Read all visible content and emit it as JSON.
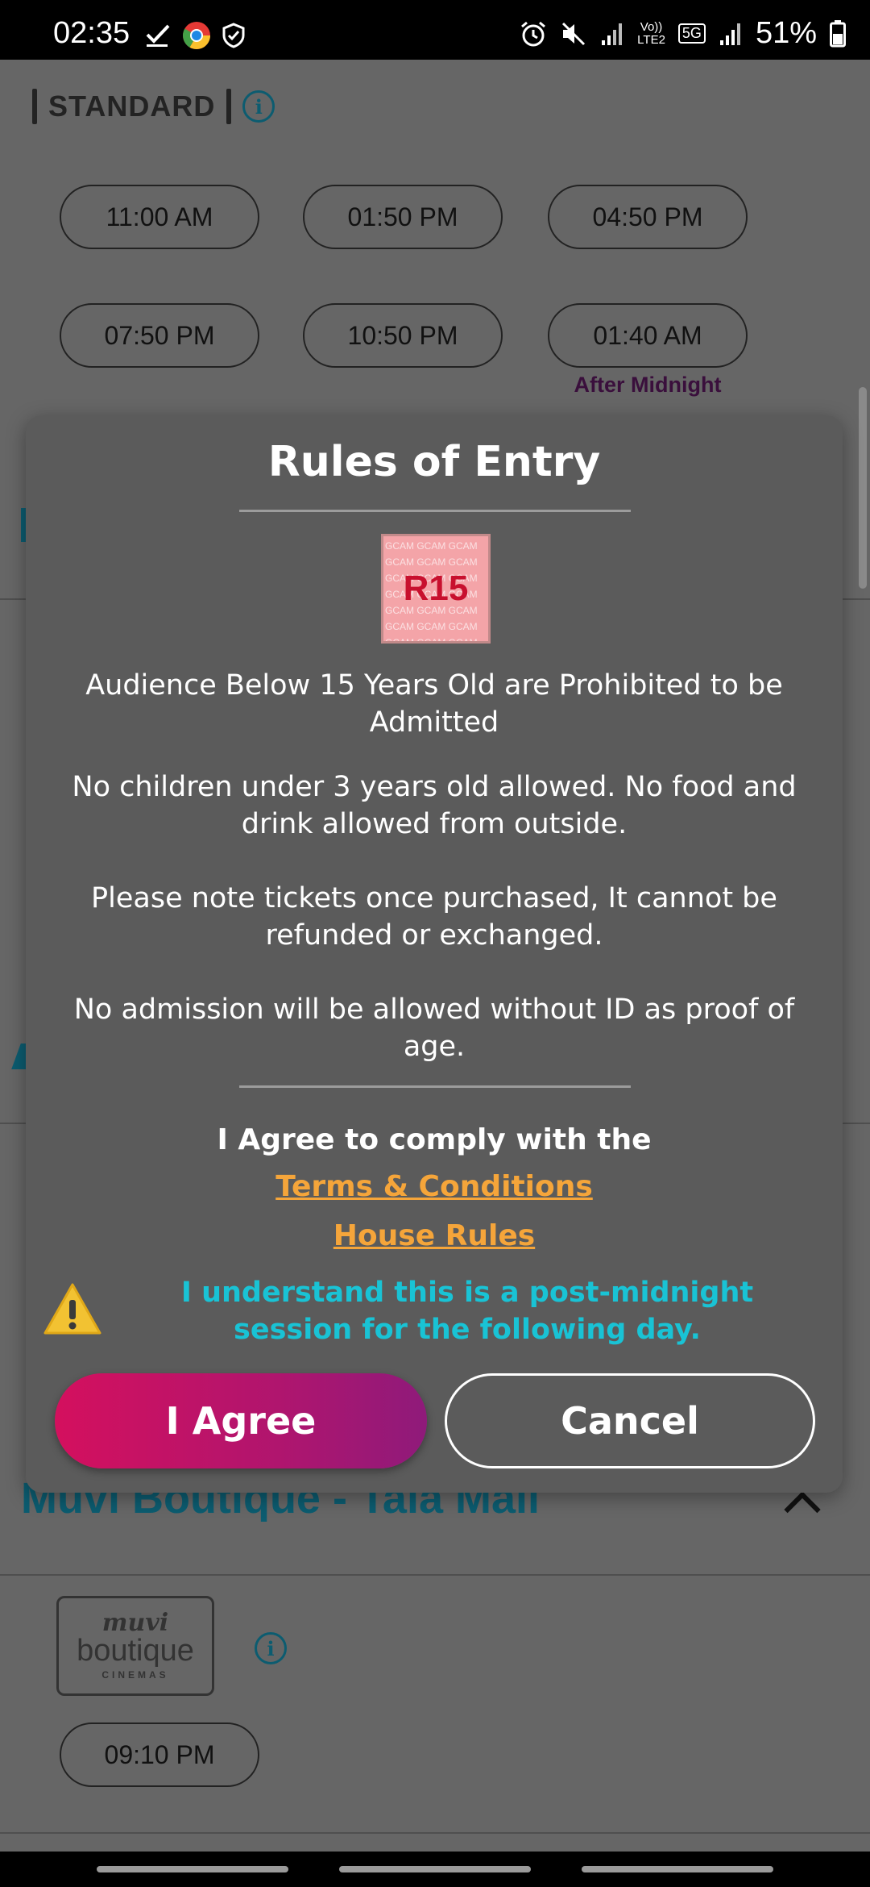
{
  "status_bar": {
    "time": "02:35",
    "battery": "51%",
    "network": "5G",
    "carrier_tag": "Vo))\nLTE2"
  },
  "background": {
    "section_label": "STANDARD",
    "showtimes": [
      "11:00 AM",
      "01:50 PM",
      "04:50 PM",
      "07:50 PM",
      "10:50 PM",
      "01:40 AM"
    ],
    "after_midnight_label": "After Midnight",
    "venue_title": "Muvi Boutique - Tala Mall",
    "venue_logo": {
      "top": "muvi",
      "middle": "boutique",
      "bottom": "CINEMAS"
    },
    "venue_showtimes": [
      "09:10 PM"
    ]
  },
  "modal": {
    "title": "Rules of Entry",
    "rating": "R15",
    "rating_pattern": "GCAM",
    "rules": [
      "Audience Below 15 Years Old are Prohibited to be Admitted",
      "No children under 3 years old allowed. No food and drink allowed from outside.",
      "Please note tickets once purchased, It cannot be refunded or exchanged.",
      "No admission will be allowed without ID as proof of age."
    ],
    "agree_heading": "I Agree to comply with the",
    "terms_link": "Terms & Conditions",
    "house_rules_link": "House Rules",
    "midnight_note": "I understand this is a post-midnight session for the following day.",
    "agree_button": "I Agree",
    "cancel_button": "Cancel"
  },
  "colors": {
    "accent_teal": "#0c5c70",
    "link_orange": "#f5a53a",
    "note_cyan": "#19c3d5",
    "agree_gradient_start": "#d4105e",
    "agree_gradient_end": "#8f1a7a",
    "rating_red": "#c8102e"
  },
  "icons": {
    "status_left": [
      "check-icon",
      "chrome-icon",
      "shield-icon"
    ],
    "status_right": [
      "alarm-icon",
      "mute-icon",
      "signal-icon",
      "battery-icon"
    ],
    "info": "info-icon",
    "warning": "warning-icon",
    "collapse": "chevron-up-icon"
  }
}
